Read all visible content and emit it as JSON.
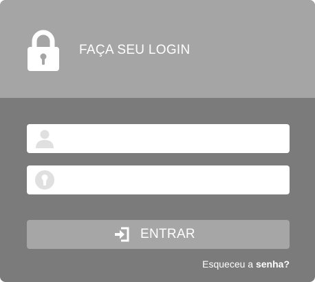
{
  "header": {
    "title": "FAÇA SEU LOGIN",
    "icon": "lock-icon"
  },
  "form": {
    "username": {
      "icon": "user-icon",
      "value": "",
      "placeholder": ""
    },
    "password": {
      "icon": "key-icon",
      "value": "",
      "placeholder": ""
    },
    "submit": {
      "icon": "enter-icon",
      "label": "ENTRAR"
    },
    "forgot": {
      "text": "Esqueceu a ",
      "emphasis": "senha?"
    }
  },
  "colors": {
    "header_bg": "#a5a5a5",
    "body_bg": "#7b7b7b",
    "button_bg": "#a6a6a6",
    "icon_gray": "#e0e0e0"
  }
}
